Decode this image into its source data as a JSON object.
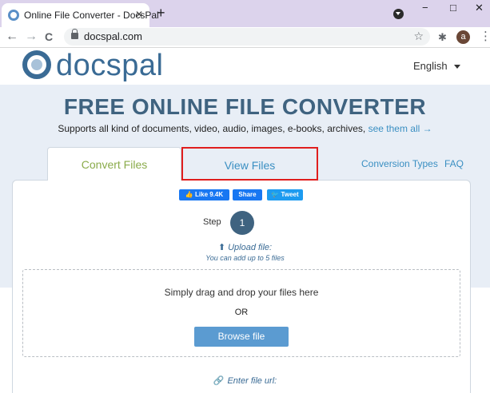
{
  "browser": {
    "tab_title": "Online File Converter - DocsPal",
    "tab_close": "✕",
    "new_tab": "+",
    "window_minimize": "−",
    "window_maximize": "□",
    "window_close": "✕",
    "back": "←",
    "forward": "→",
    "reload": "C",
    "url": "docspal.com",
    "bookmark_star": "☆",
    "extensions": "✱",
    "avatar_letter": "a",
    "menu": "⋮"
  },
  "header": {
    "logo_text": "docspal",
    "language": "English"
  },
  "hero": {
    "title": "FREE ONLINE FILE CONVERTER",
    "subtitle": "Supports all kind of documents, video, audio, images, e-books, archives, ",
    "subtitle_link": "see them all →"
  },
  "tabs": {
    "convert": "Convert Files",
    "view": "View Files",
    "conversion_types": "Conversion Types",
    "faq": "FAQ"
  },
  "social": {
    "like": "Like 9.4K",
    "share": "Share",
    "tweet": "Tweet"
  },
  "step": {
    "label": "Step",
    "number": "1"
  },
  "upload": {
    "icon": "⬆",
    "title": "Upload file:",
    "subtitle": "You can add up to 5 files",
    "drop_text": "Simply drag and drop your files here",
    "or": "OR",
    "browse_label": "Browse file"
  },
  "url_section": {
    "icon": "🔗",
    "title": "Enter file url:"
  },
  "colors": {
    "brand": "#3a6b95",
    "link": "#3a8fc2",
    "convert_tab": "#8aab4a",
    "highlight_box": "#e01e1e",
    "browse_button": "#5b9bd1"
  }
}
